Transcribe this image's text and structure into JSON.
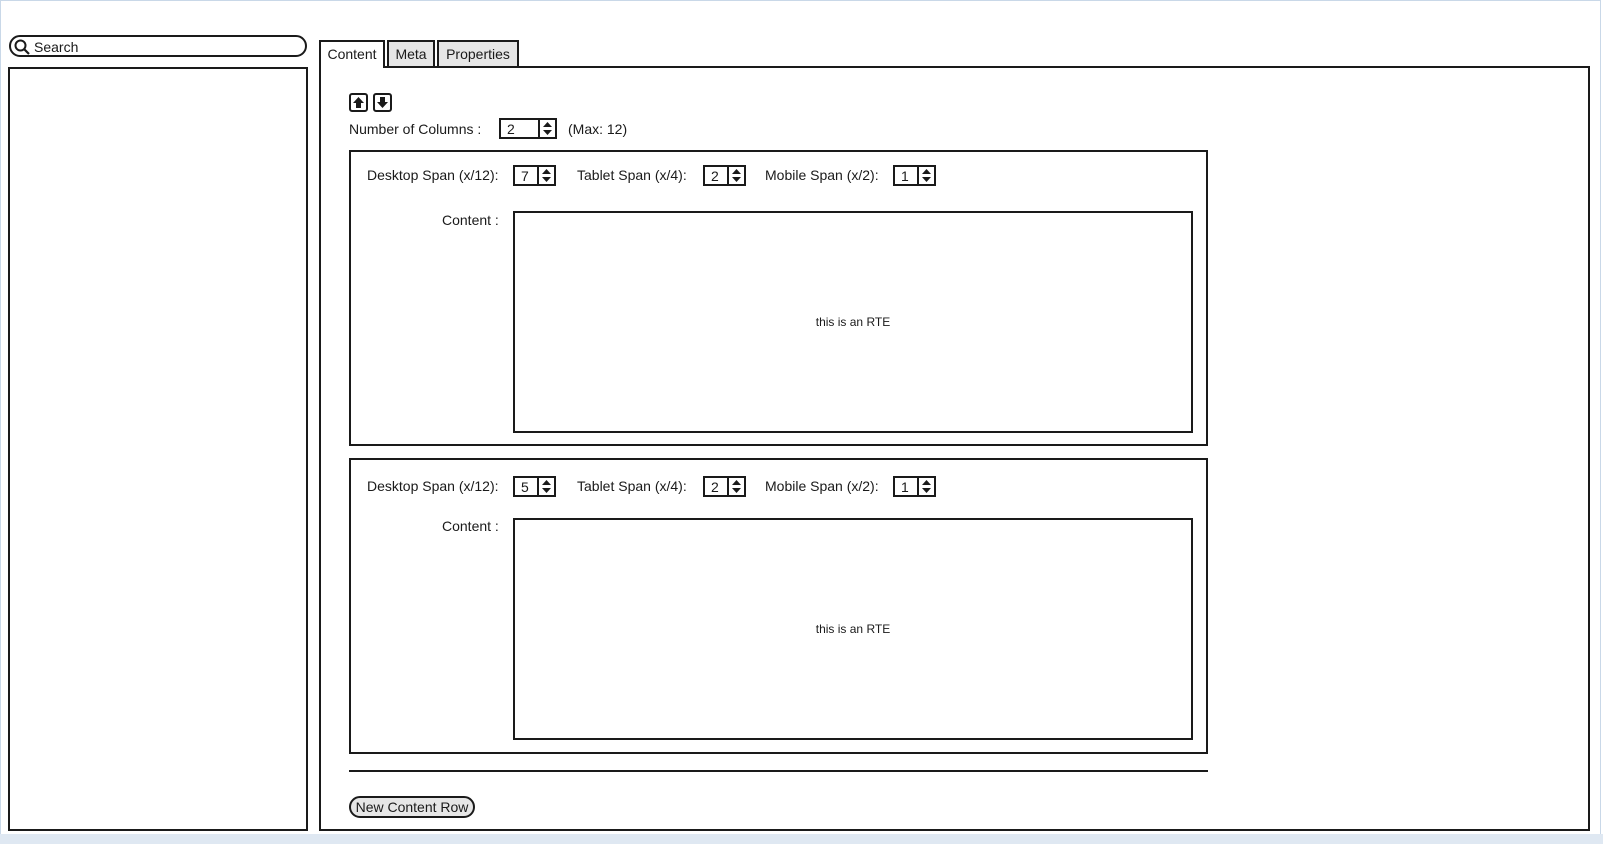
{
  "search": {
    "placeholder": "Search"
  },
  "tabs": [
    {
      "label": "Content",
      "active": true
    },
    {
      "label": "Meta",
      "active": false
    },
    {
      "label": "Properties",
      "active": false
    }
  ],
  "columns": {
    "label": "Number of Columns :",
    "value": "2",
    "max_note": "(Max: 12)"
  },
  "rows": [
    {
      "desktop_label": "Desktop Span (x/12):",
      "desktop_value": "7",
      "tablet_label": "Tablet Span (x/4):",
      "tablet_value": "2",
      "mobile_label": "Mobile Span (x/2):",
      "mobile_value": "1",
      "content_label": "Content :",
      "rte_text": "this is an RTE"
    },
    {
      "desktop_label": "Desktop Span (x/12):",
      "desktop_value": "5",
      "tablet_label": "Tablet Span (x/4):",
      "tablet_value": "2",
      "mobile_label": "Mobile Span (x/2):",
      "mobile_value": "1",
      "content_label": "Content :",
      "rte_text": "this is an RTE"
    }
  ],
  "new_row_button": "New Content Row",
  "icons": {
    "search": "search-icon",
    "move_up": "arrow-up-icon",
    "move_down": "arrow-down-icon",
    "spinner": "spinner-arrows-icon"
  }
}
